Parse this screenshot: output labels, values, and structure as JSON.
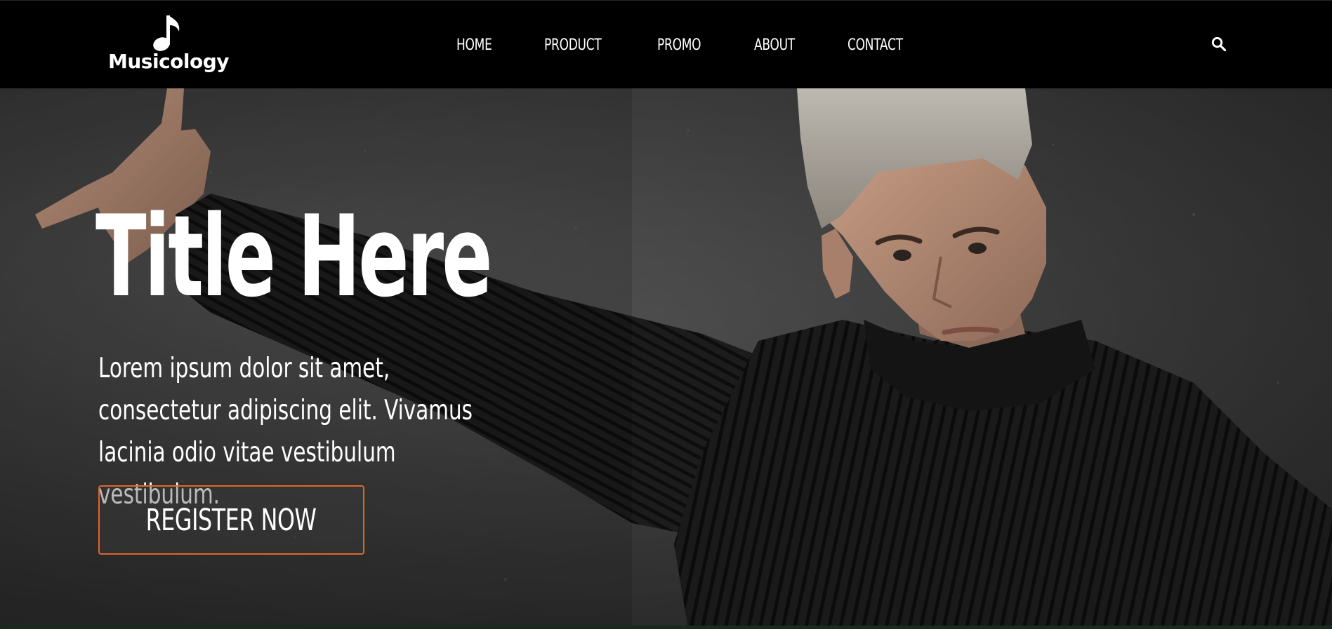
{
  "brand": {
    "name": "Musicology",
    "logo_icon": "music-note-icon"
  },
  "nav": {
    "items": [
      {
        "label": "HOME"
      },
      {
        "label": "PRODUCT"
      },
      {
        "label": "PROMO"
      },
      {
        "label": "ABOUT"
      },
      {
        "label": "CONTACT"
      }
    ],
    "search_icon": "search-icon"
  },
  "hero": {
    "title": "Title Here",
    "description": "Lorem ipsum dolor sit amet, consectetur adipiscing elit. Vivamus lacinia odio vitae vestibulum vestibulum.",
    "cta_label": "REGISTER NOW",
    "image": "man-in-black-turtleneck-photo"
  },
  "colors": {
    "header_bg": "#000000",
    "accent": "#e0652a",
    "text": "#ffffff"
  }
}
